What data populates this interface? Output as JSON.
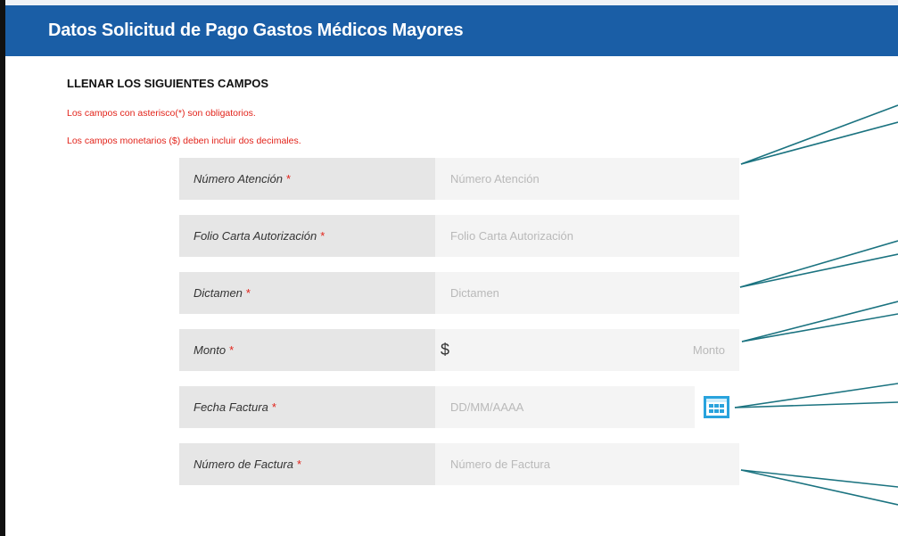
{
  "header": {
    "title": "Datos Solicitud de Pago Gastos Médicos Mayores"
  },
  "form": {
    "section_title": "LLENAR LOS SIGUIENTES CAMPOS",
    "note_required": "Los campos con asterisco(*) son obligatorios.",
    "note_money": "Los campos monetarios ($) deben incluir dos decimales.",
    "required_mark": "*",
    "fields": [
      {
        "label": "Número Atención",
        "placeholder": "Número Atención",
        "value": ""
      },
      {
        "label": "Folio Carta Autorización",
        "placeholder": "Folio Carta Autorización",
        "value": ""
      },
      {
        "label": "Dictamen",
        "placeholder": "Dictamen",
        "value": ""
      },
      {
        "label": "Monto",
        "placeholder": "Monto",
        "currency_symbol": "$",
        "value": ""
      },
      {
        "label": "Fecha Factura",
        "placeholder": "DD/MM/AAAA",
        "value": "",
        "icon": "calendar-icon"
      },
      {
        "label": "Número de Factura",
        "placeholder": "Número de Factura",
        "value": ""
      }
    ]
  },
  "colors": {
    "header_bg": "#1a5ea6",
    "required": "#e2231a",
    "calendar_icon": "#29a3dd",
    "callout_line": "#1b7380"
  }
}
